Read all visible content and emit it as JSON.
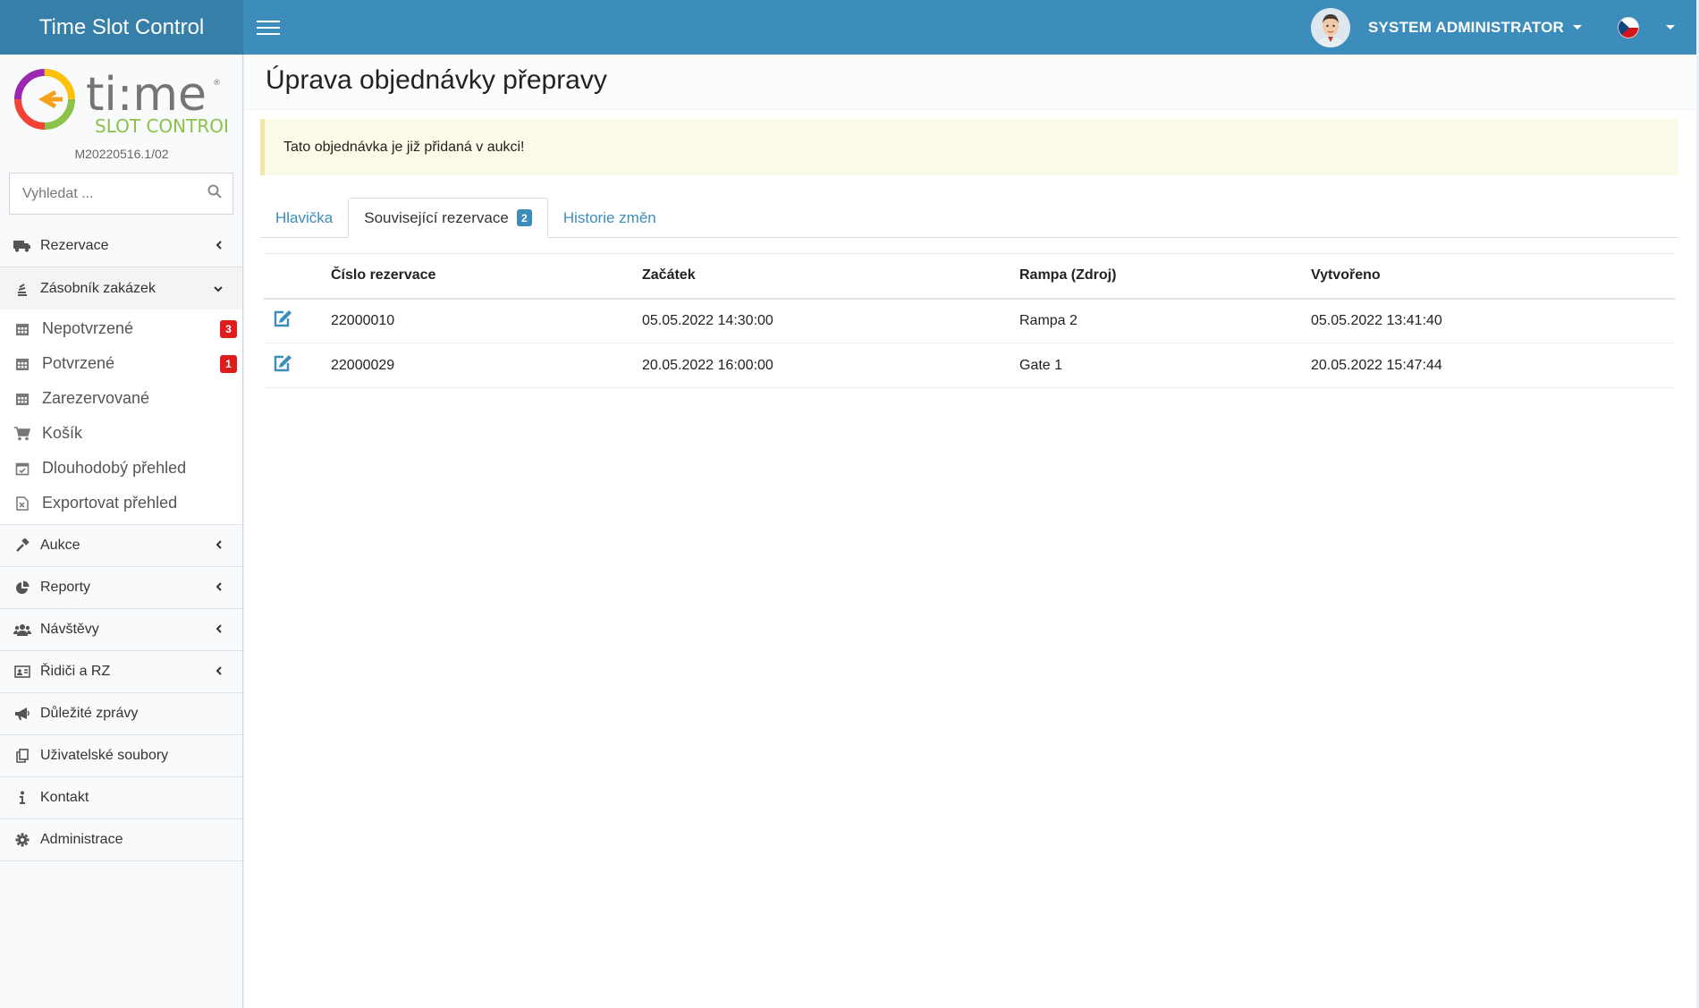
{
  "app": {
    "title": "Time Slot Control"
  },
  "header": {
    "user_name": "SYSTEM ADMINISTRATOR"
  },
  "sidebar": {
    "version": "M20220516.1/02",
    "search_placeholder": "Vyhledat ...",
    "menu": [
      {
        "label": "Rezervace",
        "icon": "truck-icon"
      },
      {
        "label": "Zásobník zakázek",
        "icon": "stack-icon",
        "open": true
      },
      {
        "label": "Aukce",
        "icon": "gavel-icon"
      },
      {
        "label": "Reporty",
        "icon": "pie-chart-icon"
      },
      {
        "label": "Návštěvy",
        "icon": "users-icon"
      },
      {
        "label": "Řidiči a RZ",
        "icon": "id-card-icon"
      },
      {
        "label": "Důležité zprávy",
        "icon": "megaphone-icon"
      },
      {
        "label": "Uživatelské soubory",
        "icon": "files-icon"
      },
      {
        "label": "Kontakt",
        "icon": "info-icon"
      },
      {
        "label": "Administrace",
        "icon": "gear-icon"
      }
    ],
    "submenu": [
      {
        "label": "Nepotvrzené",
        "badge": "3",
        "icon": "calendar-icon"
      },
      {
        "label": "Potvrzené",
        "badge": "1",
        "icon": "calendar-icon"
      },
      {
        "label": "Zarezervované",
        "icon": "calendar-icon"
      },
      {
        "label": "Košík",
        "icon": "cart-icon"
      },
      {
        "label": "Dlouhodobý přehled",
        "icon": "calendar-check-icon"
      },
      {
        "label": "Exportovat přehled",
        "icon": "excel-file-icon"
      }
    ]
  },
  "page": {
    "title": "Úprava objednávky přepravy",
    "alert": "Tato objednávka je již přidaná v aukci!",
    "tabs": [
      {
        "label": "Hlavička"
      },
      {
        "label": "Související rezervace",
        "badge": "2",
        "active": true
      },
      {
        "label": "Historie změn"
      }
    ]
  },
  "table": {
    "headers": [
      "Číslo rezervace",
      "Začátek",
      "Rampa (Zdroj)",
      "Vytvořeno"
    ],
    "rows": [
      [
        "22000010",
        "05.05.2022 14:30:00",
        "Rampa 2",
        "05.05.2022 13:41:40"
      ],
      [
        "22000029",
        "20.05.2022 16:00:00",
        "Gate 1",
        "20.05.2022 15:47:44"
      ]
    ]
  },
  "colors": {
    "primary": "#3c8dbc",
    "brand_dark": "#367fa9",
    "badge_red": "#dd1c1c",
    "alert_bg": "#fcfae8"
  }
}
